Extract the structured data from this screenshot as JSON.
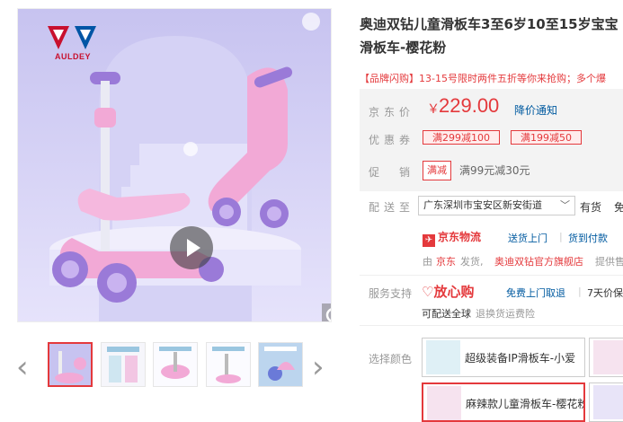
{
  "brand": {
    "logo_text": "AULDEY"
  },
  "product": {
    "title_line1": "奥迪双钻儿童滑板车3至6岁10至15岁宝宝",
    "title_line2": "滑板车-樱花粉",
    "promo": "【品牌闪购】13-15号限时两件五折等你来抢购；多个爆"
  },
  "price": {
    "label": "京东价",
    "currency": "￥",
    "value": "229.00",
    "notice": "降价通知"
  },
  "coupons": {
    "label": "优惠券",
    "items": [
      "满299减100",
      "满199减50"
    ]
  },
  "promotion": {
    "label": "促　销",
    "tag": "满减",
    "text": "满99元减30元"
  },
  "delivery": {
    "label": "配送至",
    "address": "广东深圳市宝安区新安街道",
    "stock": "有货",
    "extra": "免",
    "logistics_name": "京东物流",
    "links": [
      "送货上门",
      "货到付款"
    ],
    "sold_by_prefix": "由",
    "sold_by_jd": "京东",
    "sold_by_mid": "发货,",
    "store": "奥迪双钻官方旗舰店",
    "service_suffix": "提供售"
  },
  "service": {
    "label": "服务支持",
    "logo": "放心购",
    "items": [
      "免费上门取退",
      "7天价保"
    ],
    "extra": "可配送全球",
    "insurance": "退换货运费险"
  },
  "variants": {
    "label": "选择颜色",
    "items": [
      {
        "label": "超级装备IP滑板车-小爱",
        "selected": false
      },
      {
        "label": "",
        "selected": false
      },
      {
        "label": "麻辣款儿童滑板车-樱花粉",
        "selected": true
      },
      {
        "label": "",
        "selected": false
      }
    ]
  },
  "gallery": {
    "thumb_count": 5,
    "active_index": 0
  },
  "colors": {
    "accent": "#e4393c",
    "link": "#005aa0",
    "price_bg": "#f3f3f3",
    "scooter_pink": "#f2a9d6",
    "scooter_purple": "#9a7ad8"
  },
  "icons": [
    "play-icon",
    "zoom-icon",
    "arrow-left-icon",
    "arrow-right-icon",
    "chevron-down-icon",
    "heart-icon"
  ]
}
